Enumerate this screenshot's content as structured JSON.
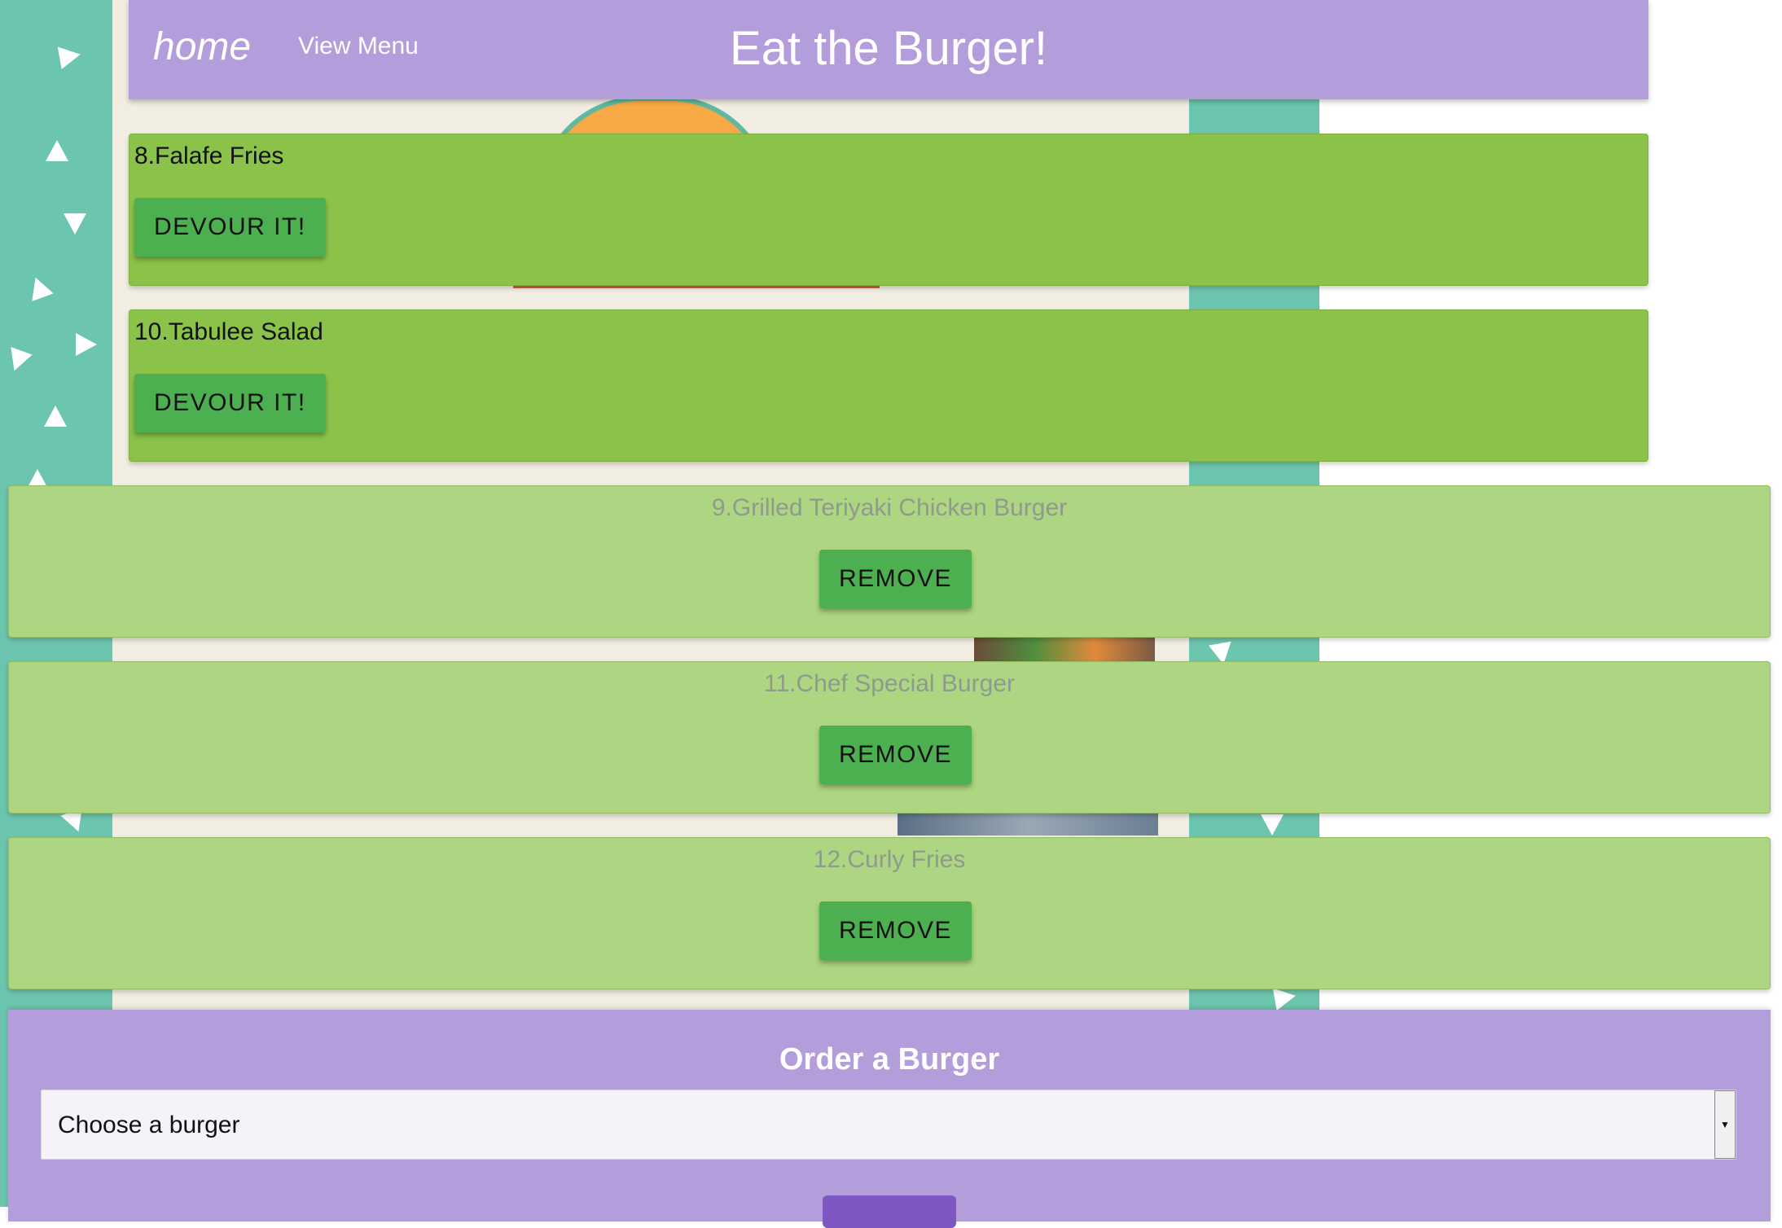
{
  "navbar": {
    "home_label": "home",
    "menu_label": "View Menu",
    "title": "Eat the Burger!"
  },
  "uneaten": [
    {
      "name": "8.Falafe Fries",
      "button": "DEVOUR IT!"
    },
    {
      "name": "10.Tabulee Salad",
      "button": "DEVOUR IT!"
    }
  ],
  "devoured": [
    {
      "name": "9.Grilled Teriyaki Chicken Burger",
      "button": "REMOVE"
    },
    {
      "name": "11.Chef Special Burger",
      "button": "REMOVE"
    },
    {
      "name": "12.Curly Fries",
      "button": "REMOVE"
    }
  ],
  "order": {
    "title": "Order a Burger",
    "select_value": "Choose a burger"
  },
  "colors": {
    "nav_purple": "#b39ddb",
    "devour_green": "#8bc34a",
    "devoured_green": "#aed581",
    "button_green": "#4caf50",
    "background_teal": "#6cc5ae"
  }
}
